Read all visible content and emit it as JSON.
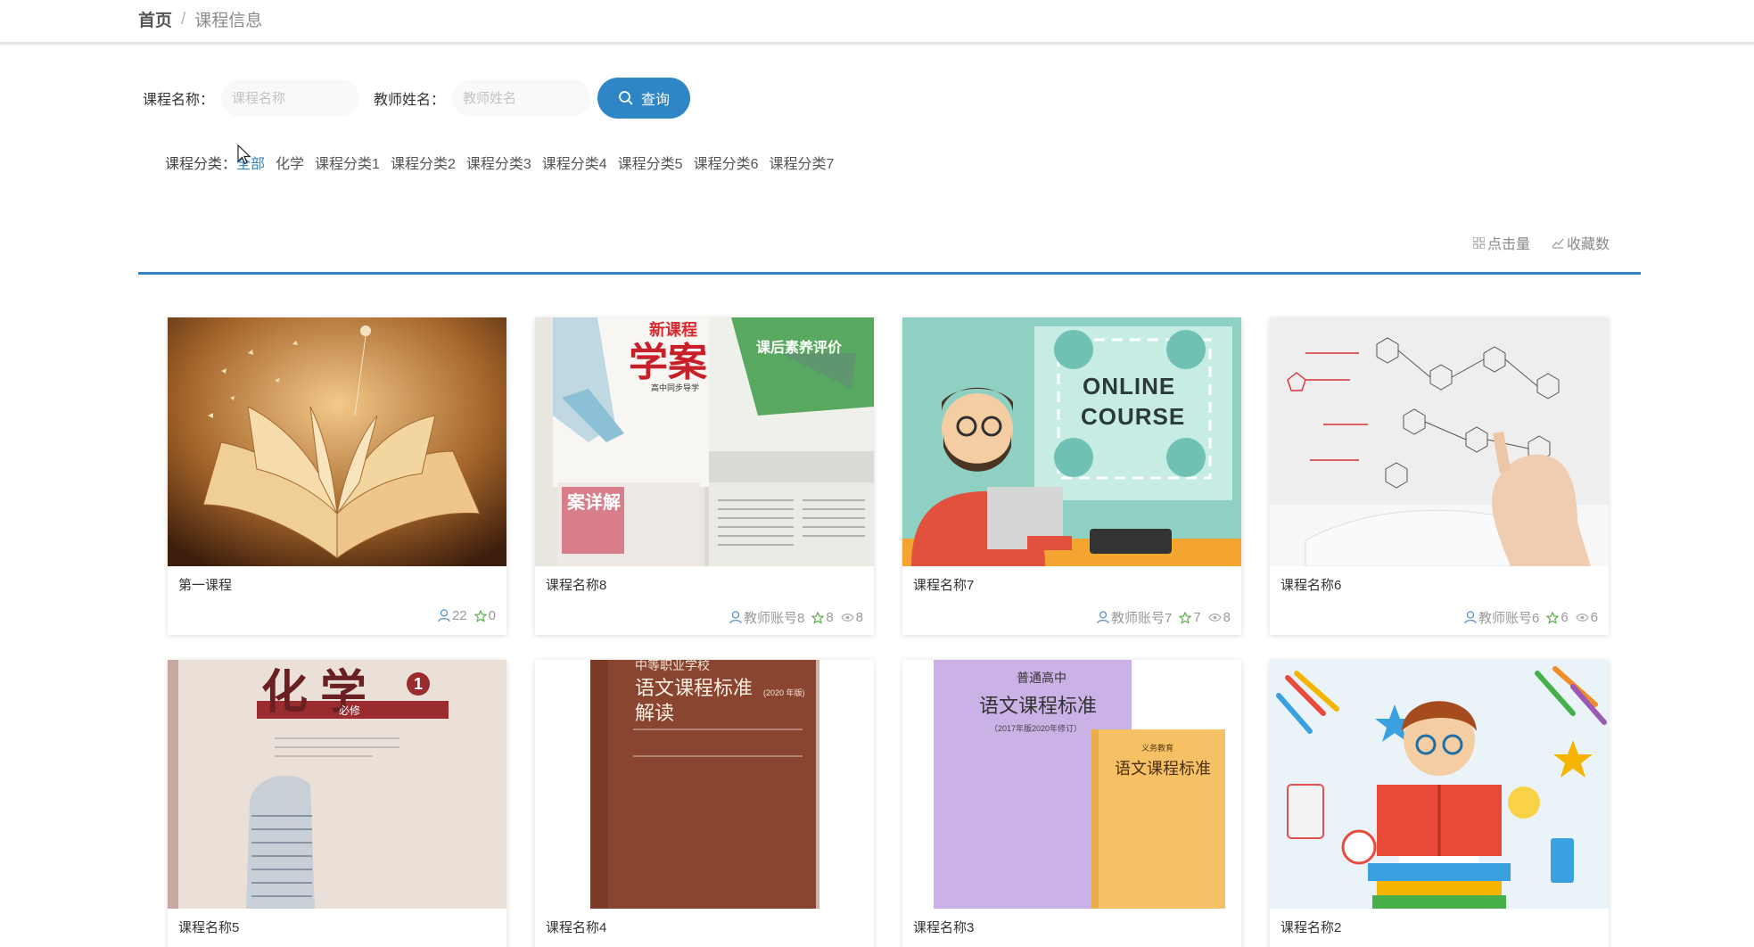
{
  "breadcrumb": {
    "home": "首页",
    "separator": "/",
    "current": "课程信息"
  },
  "search": {
    "course_label": "课程名称：",
    "course_placeholder": "课程名称",
    "teacher_label": "教师姓名：",
    "teacher_placeholder": "教师姓名",
    "button_label": "查询"
  },
  "categories": {
    "label": "课程分类：",
    "items": [
      "全部",
      "化学",
      "课程分类1",
      "课程分类2",
      "课程分类3",
      "课程分类4",
      "课程分类5",
      "课程分类6",
      "课程分类7"
    ],
    "active": "全部"
  },
  "sort": {
    "clicks": "点击量",
    "favorites": "收藏数"
  },
  "colors": {
    "accent": "#2e86c6",
    "muted": "#999999"
  },
  "courses": [
    {
      "title": "第一课程",
      "teacher": "22",
      "stars": "0",
      "views": ""
    },
    {
      "title": "课程名称8",
      "teacher": "教师账号8",
      "stars": "8",
      "views": "8"
    },
    {
      "title": "课程名称7",
      "teacher": "教师账号7",
      "stars": "7",
      "views": "8"
    },
    {
      "title": "课程名称6",
      "teacher": "教师账号6",
      "stars": "6",
      "views": "6"
    },
    {
      "title": "课程名称5"
    },
    {
      "title": "课程名称4"
    },
    {
      "title": "课程名称3"
    },
    {
      "title": "课程名称2"
    }
  ],
  "images": {
    "card2_big": "学案",
    "card2_small": "新课程",
    "card2_sub": "高中同步导学",
    "card2_right": "课后素养评价",
    "card2_bottom": "案详解",
    "card3_line1": "ONLINE",
    "card3_line2": "COURSE",
    "card5_title": "化学",
    "card5_num": "1",
    "card5_sub": "必修",
    "card6_title1": "语文课程标准",
    "card6_title2": "解读",
    "card6_top": "中等职业学校",
    "card6_year": "(2020 年版)",
    "card7_top": "普通高中",
    "card7_title": "语文课程标准",
    "card7_year": "（2017年版2020年修订）",
    "card7_book_title": "语文课程标准",
    "card7_book_top": "义务教育"
  }
}
